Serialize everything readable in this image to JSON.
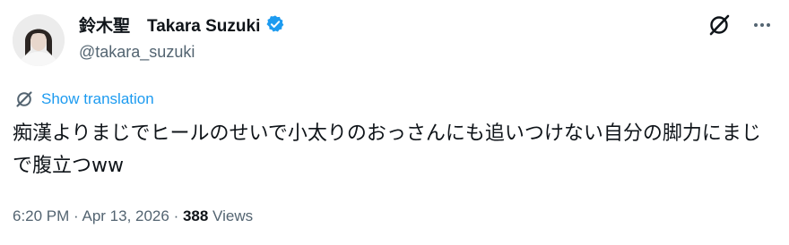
{
  "author": {
    "display_name": "鈴木聖　Takara Suzuki",
    "handle": "@takara_suzuki",
    "verified": true,
    "verified_color": "#1d9bf0"
  },
  "header_icons": [
    "grok-icon",
    "more-icon"
  ],
  "translation": {
    "label": "Show translation",
    "icon": "translate-icon",
    "color": "#1d9bf0"
  },
  "tweet": {
    "text": "痴漢よりまじでヒールのせいで小太りのおっさんにも追いつけない自分の脚力にまじで腹立つww"
  },
  "meta": {
    "time": "6:20 PM",
    "separator": " · ",
    "date": "Apr 13, 2026",
    "views_count": "388",
    "views_label": " Views"
  }
}
